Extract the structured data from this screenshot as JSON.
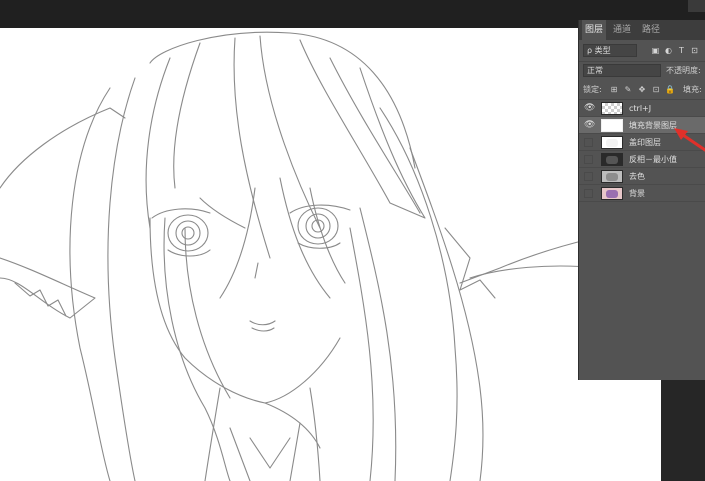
{
  "panel": {
    "tabs": [
      {
        "label": "图层",
        "active": true
      },
      {
        "label": "通道",
        "active": false
      },
      {
        "label": "路径",
        "active": false
      }
    ],
    "filter": {
      "kind_label": "ρ 类型"
    },
    "blend_mode": "正常",
    "opacity_label": "不透明度:",
    "lock_label": "锁定:",
    "fill_label": "填充:"
  },
  "layers": [
    {
      "name": "ctrl+J",
      "visible": true,
      "selected": false,
      "thumb": "checker"
    },
    {
      "name": "填充背景图层",
      "visible": true,
      "selected": true,
      "thumb": "white"
    },
    {
      "name": "盖印图层",
      "visible": false,
      "selected": false,
      "thumb": "white"
    },
    {
      "name": "反相－最小值",
      "visible": false,
      "selected": false,
      "thumb": "dark"
    },
    {
      "name": "去色",
      "visible": false,
      "selected": false,
      "thumb": "gray"
    },
    {
      "name": "背景",
      "visible": false,
      "selected": false,
      "thumb": "color"
    }
  ],
  "colors": {
    "panel_bg": "#535353",
    "selected_row": "#6a6a6a",
    "annotation_arrow": "#e0302a",
    "canvas_bg": "#ffffff",
    "workspace_bg": "#282828"
  },
  "icons": {
    "visible_eye": "eye-icon",
    "arrow": "red-arrow-annotation"
  }
}
